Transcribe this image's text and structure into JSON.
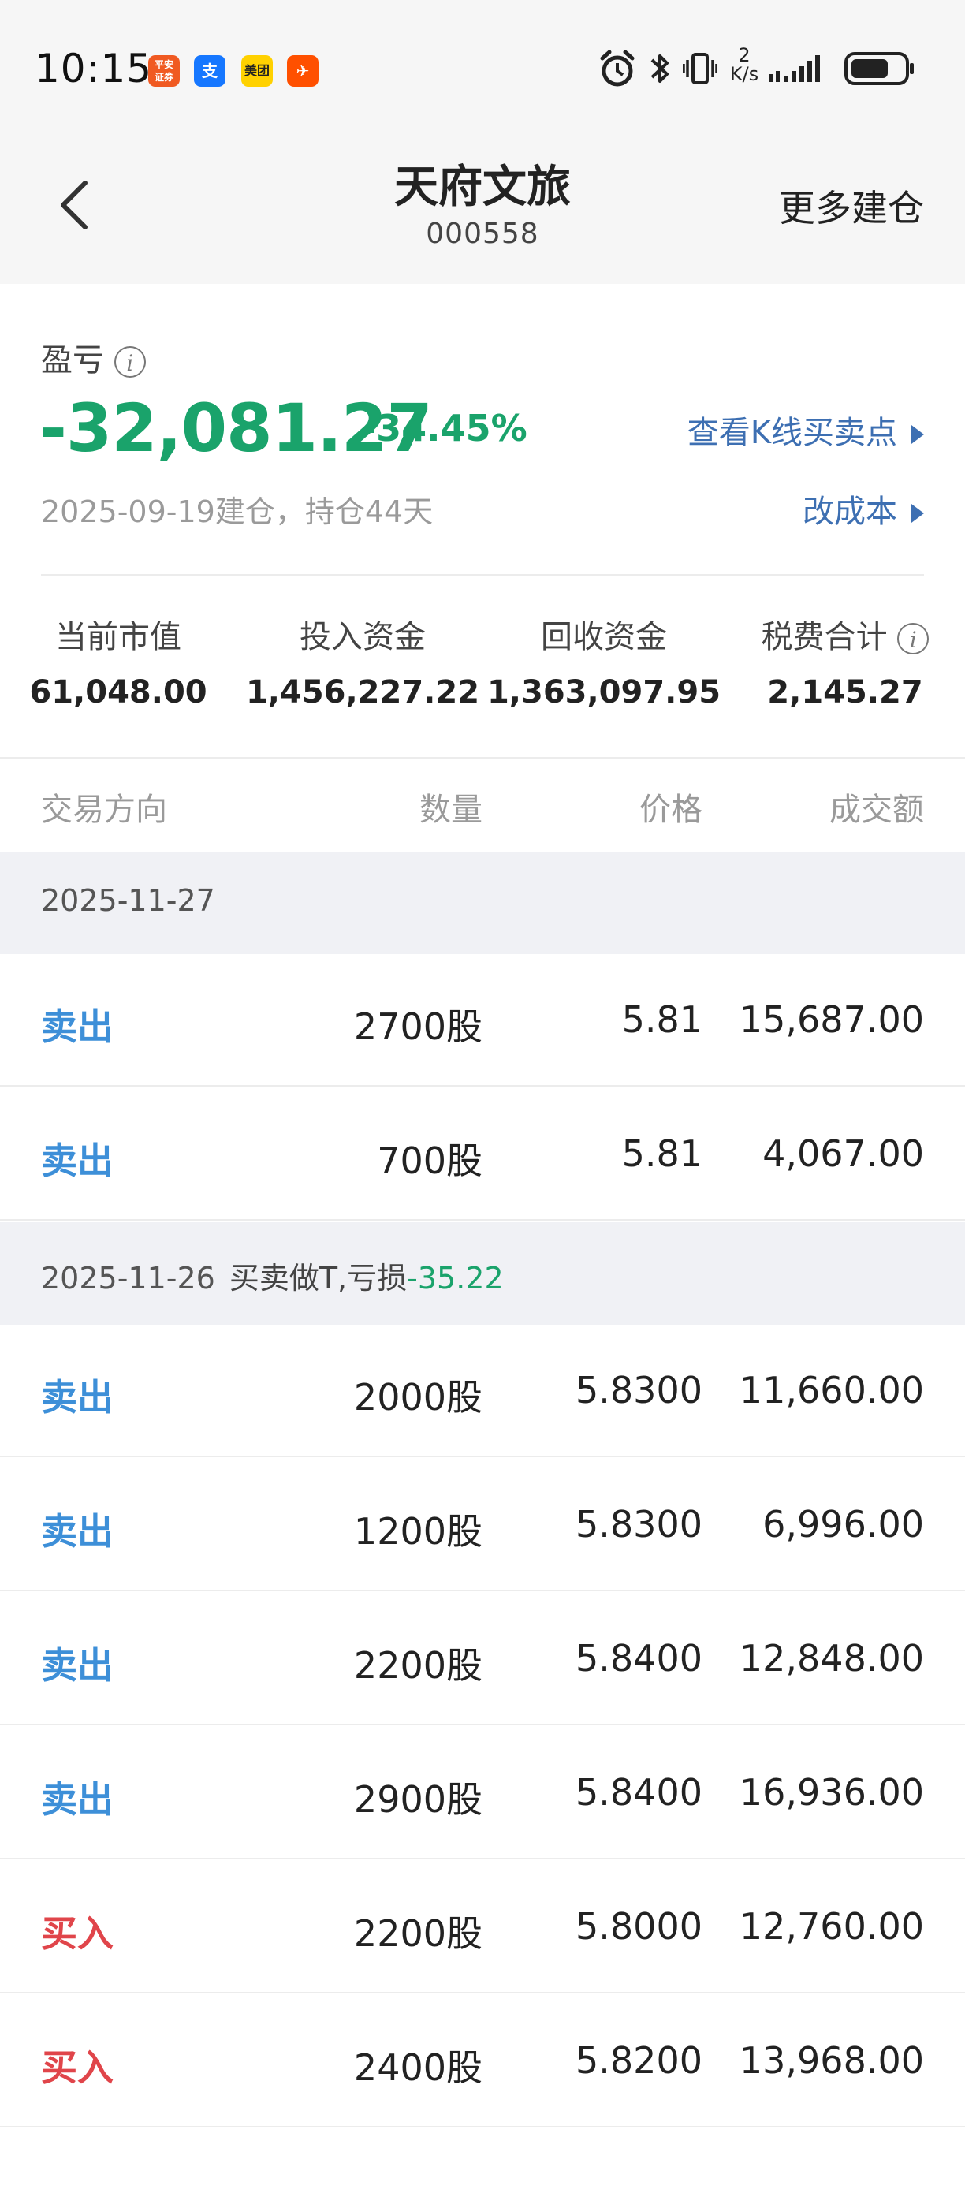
{
  "status_bar": {
    "time": "10:15",
    "app_icons": [
      {
        "name": "pingan-securities-icon",
        "glyph": "平安\n证券",
        "color": "#f05a22"
      },
      {
        "name": "alipay-icon",
        "glyph": "支",
        "color": "#1677ff"
      },
      {
        "name": "meituan-icon",
        "glyph": "美团",
        "color": "#ffd100"
      },
      {
        "name": "app-orange-icon",
        "glyph": "✈",
        "color": "#ff5000"
      }
    ],
    "net_speed_top": "2",
    "net_speed_bottom": "K/s"
  },
  "header": {
    "title": "天府文旅",
    "code": "000558",
    "more_label": "更多建仓"
  },
  "summary": {
    "pl_label": "盈亏",
    "pl_value": "-32,081.27",
    "pl_pct": "-34.45%",
    "kline_link": "查看K线买卖点",
    "build_info": "2025-09-19建仓，持仓44天",
    "cost_link": "改成本"
  },
  "stats": [
    {
      "label": "当前市值",
      "value": "61,048.00"
    },
    {
      "label": "投入资金",
      "value": "1,456,227.22"
    },
    {
      "label": "回收资金",
      "value": "1,363,097.95"
    },
    {
      "label": "税费合计",
      "value": "2,145.27"
    }
  ],
  "table": {
    "headers": {
      "direction": "交易方向",
      "qty": "数量",
      "price": "价格",
      "amount": "成交额"
    },
    "groups": [
      {
        "date": "2025-11-27",
        "note": "",
        "loss": "",
        "rows": [
          {
            "direction": "卖出",
            "type": "sell",
            "qty": "2700股",
            "price": "5.81",
            "amount": "15,687.00"
          },
          {
            "direction": "卖出",
            "type": "sell",
            "qty": "700股",
            "price": "5.81",
            "amount": "4,067.00"
          }
        ]
      },
      {
        "date": "2025-11-26",
        "note": "买卖做T,亏损",
        "loss": "-35.22",
        "rows": [
          {
            "direction": "卖出",
            "type": "sell",
            "qty": "2000股",
            "price": "5.8300",
            "amount": "11,660.00"
          },
          {
            "direction": "卖出",
            "type": "sell",
            "qty": "1200股",
            "price": "5.8300",
            "amount": "6,996.00"
          },
          {
            "direction": "卖出",
            "type": "sell",
            "qty": "2200股",
            "price": "5.8400",
            "amount": "12,848.00"
          },
          {
            "direction": "卖出",
            "type": "sell",
            "qty": "2900股",
            "price": "5.8400",
            "amount": "16,936.00"
          },
          {
            "direction": "买入",
            "type": "buy",
            "qty": "2200股",
            "price": "5.8000",
            "amount": "12,760.00"
          },
          {
            "direction": "买入",
            "type": "buy",
            "qty": "2400股",
            "price": "5.8200",
            "amount": "13,968.00"
          }
        ]
      }
    ]
  }
}
